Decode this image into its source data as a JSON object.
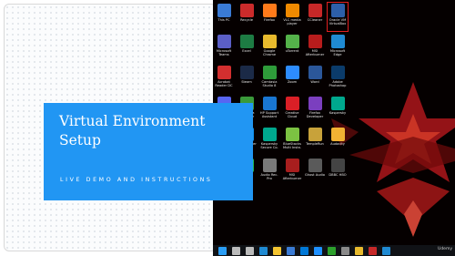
{
  "slide": {
    "title": "Virtual Environment Setup",
    "subtitle": "LIVE DEMO AND INSTRUCTIONS",
    "accent_color": "#2196f3"
  },
  "desktop": {
    "icons": [
      {
        "label": "This PC",
        "color": "#3a7bd5",
        "name": "this-pc-icon"
      },
      {
        "label": "Recycle",
        "color": "#cc2b2b",
        "name": "recycle-bin-icon"
      },
      {
        "label": "Firefox",
        "color": "#ff7a1a",
        "name": "firefox-icon"
      },
      {
        "label": "VLC media player",
        "color": "#f08a00",
        "name": "vlc-icon"
      },
      {
        "label": "CCleaner",
        "color": "#c62828",
        "name": "ccleaner-icon"
      },
      {
        "label": "Oracle VM VirtualBox",
        "color": "#2d5fa8",
        "name": "virtualbox-icon",
        "selected": true
      },
      {
        "label": "Microsoft Teams",
        "color": "#5b5fc7",
        "name": "teams-icon"
      },
      {
        "label": "Excel",
        "color": "#1d7c43",
        "name": "excel-icon"
      },
      {
        "label": "Google Chrome",
        "color": "#e8ba2d",
        "name": "chrome-icon"
      },
      {
        "label": "uTorrent",
        "color": "#54b24a",
        "name": "utorrent-icon"
      },
      {
        "label": "MSI Afterburner",
        "color": "#b71c1c",
        "name": "afterburner-icon"
      },
      {
        "label": "Microsoft Edge",
        "color": "#1f8ad2",
        "name": "edge-icon"
      },
      {
        "label": "Acrobat Reader DC",
        "color": "#d32f2f",
        "name": "acrobat-icon"
      },
      {
        "label": "Steam",
        "color": "#1b2a47",
        "name": "steam-icon"
      },
      {
        "label": "Camtasia Studio 8",
        "color": "#2e9c3a",
        "name": "camtasia-icon"
      },
      {
        "label": "Zoom",
        "color": "#2d8cff",
        "name": "zoom-icon"
      },
      {
        "label": "Word",
        "color": "#2b579a",
        "name": "word-icon"
      },
      {
        "label": "Adobe Photoshop",
        "color": "#0b3b6a",
        "name": "photoshop-icon"
      },
      {
        "label": "Discord",
        "color": "#5865f2",
        "name": "discord-icon"
      },
      {
        "label": "Camtasia Recorder",
        "color": "#3a9a3a",
        "name": "camtasia-recorder-icon"
      },
      {
        "label": "HP Support Assistant",
        "color": "#1976d2",
        "name": "hp-support-icon"
      },
      {
        "label": "Creative Cloud",
        "color": "#da1f26",
        "name": "creative-cloud-icon"
      },
      {
        "label": "Firefox Developer",
        "color": "#7b3fbf",
        "name": "firefox-dev-icon"
      },
      {
        "label": "Kaspersky",
        "color": "#00a88e",
        "name": "kaspersky-icon"
      },
      {
        "label": "BlueStacks",
        "color": "#73b83d",
        "name": "bluestacks-icon"
      },
      {
        "label": "TeamViewer",
        "color": "#0e8ee9",
        "name": "teamviewer-icon"
      },
      {
        "label": "Kaspersky Secure Co.",
        "color": "#00a88e",
        "name": "kaspersky-secure-icon"
      },
      {
        "label": "BlueStacks Multi Insta.",
        "color": "#7cc242",
        "name": "bluestacks-multi-icon"
      },
      {
        "label": "TempleRun",
        "color": "#c8a23a",
        "name": "templerun-icon"
      },
      {
        "label": "Audacity",
        "color": "#f2b233",
        "name": "audacity-icon"
      },
      {
        "label": "MS Paint",
        "color": "#2a7dd4",
        "name": "paint-icon"
      },
      {
        "label": "Spotify",
        "color": "#1db954",
        "name": "spotify-icon"
      },
      {
        "label": "Audio Rec. Pro",
        "color": "#7a7a7a",
        "name": "audio-rec-icon"
      },
      {
        "label": "MSI Afterburner",
        "color": "#a81e1e",
        "name": "afterburner2-icon"
      },
      {
        "label": "Ghost Audio",
        "color": "#5a5a5a",
        "name": "ghost-audio-icon"
      },
      {
        "label": "DBBC HBO",
        "color": "#444444",
        "name": "dbbc-icon"
      }
    ],
    "taskbar": [
      {
        "name": "start-button-icon",
        "color": "#2a9df4"
      },
      {
        "name": "search-icon",
        "color": "#bbbbbb"
      },
      {
        "name": "task-view-icon",
        "color": "#bbbbbb"
      },
      {
        "name": "edge-taskbar-icon",
        "color": "#1f8ad2"
      },
      {
        "name": "file-explorer-icon",
        "color": "#f4c430"
      },
      {
        "name": "store-icon",
        "color": "#3a7bd5"
      },
      {
        "name": "mail-icon",
        "color": "#0078d7"
      },
      {
        "name": "photos-icon",
        "color": "#1e90ff"
      },
      {
        "name": "xbox-icon",
        "color": "#2ca02c"
      },
      {
        "name": "settings-icon",
        "color": "#8a8a8a"
      },
      {
        "name": "chrome-taskbar-icon",
        "color": "#e8ba2d"
      },
      {
        "name": "ccleaner-taskbar-icon",
        "color": "#c62828"
      },
      {
        "name": "windows-taskbar-icon",
        "color": "#1f8ad2"
      }
    ],
    "watermark": "Udemy"
  }
}
